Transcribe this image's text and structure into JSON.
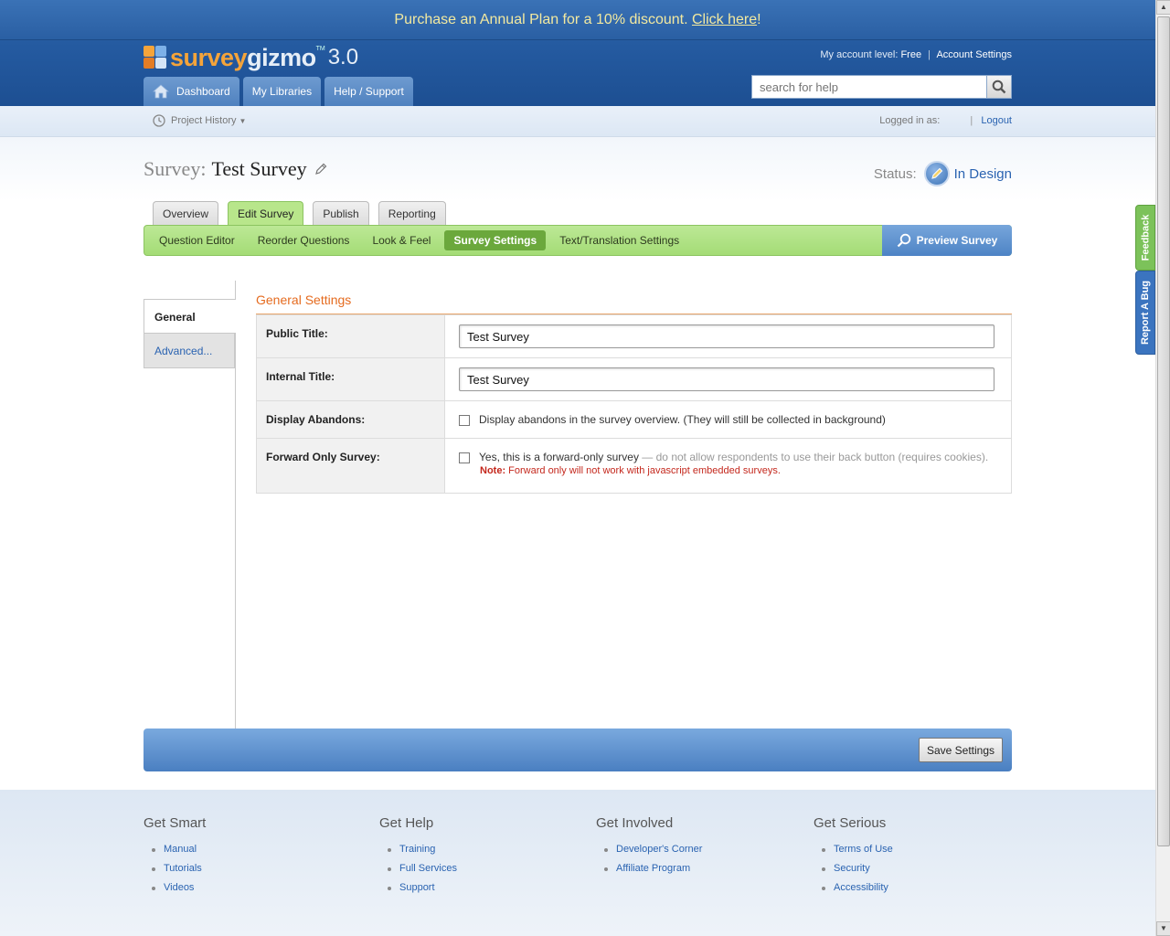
{
  "promo": {
    "text": "Purchase an Annual Plan for a 10% discount. ",
    "link": "Click here",
    "end": "!"
  },
  "logo": {
    "part1": "survey",
    "part2": "gizmo",
    "tm": "TM",
    "version": "3.0"
  },
  "account": {
    "level_label": "My account level:",
    "level": "Free",
    "settings": "Account Settings"
  },
  "search": {
    "placeholder": "search for help"
  },
  "nav": {
    "dashboard": "Dashboard",
    "libraries": "My Libraries",
    "help": "Help / Support"
  },
  "subbar": {
    "project_history": "Project History",
    "logged_in": "Logged in as:",
    "logout": "Logout"
  },
  "survey": {
    "label": "Survey:",
    "name": "Test Survey"
  },
  "status": {
    "label": "Status:",
    "value": "In Design"
  },
  "tabs": [
    {
      "label": "Overview"
    },
    {
      "label": "Edit Survey"
    },
    {
      "label": "Publish"
    },
    {
      "label": "Reporting"
    }
  ],
  "subtabs": [
    {
      "label": "Question Editor"
    },
    {
      "label": "Reorder Questions"
    },
    {
      "label": "Look & Feel"
    },
    {
      "label": "Survey Settings"
    },
    {
      "label": "Text/Translation Settings"
    }
  ],
  "preview": "Preview Survey",
  "leftnav": {
    "general": "General",
    "advanced": "Advanced..."
  },
  "settings": {
    "heading": "General Settings",
    "public_title_label": "Public Title:",
    "public_title_value": "Test Survey",
    "internal_title_label": "Internal Title:",
    "internal_title_value": "Test Survey",
    "abandons_label": "Display Abandons:",
    "abandons_text": "Display abandons in the survey overview. (They will still be collected in background)",
    "forward_label": "Forward Only Survey:",
    "forward_text": "Yes, this is a forward-only survey",
    "forward_muted": " — do not allow respondents to use their back button (requires cookies).",
    "note_label": "Note:",
    "note_text": " Forward only will not work with javascript embedded surveys."
  },
  "save": "Save Settings",
  "footer": {
    "smart": {
      "title": "Get Smart",
      "links": [
        "Manual",
        "Tutorials",
        "Videos"
      ]
    },
    "help": {
      "title": "Get Help",
      "links": [
        "Training",
        "Full Services",
        "Support"
      ]
    },
    "involved": {
      "title": "Get Involved",
      "links": [
        "Developer's Corner",
        "Affiliate Program"
      ]
    },
    "serious": {
      "title": "Get Serious",
      "links": [
        "Terms of Use",
        "Security",
        "Accessibility"
      ]
    }
  },
  "sidetabs": {
    "feedback": "Feedback",
    "bug": "Report A Bug"
  }
}
